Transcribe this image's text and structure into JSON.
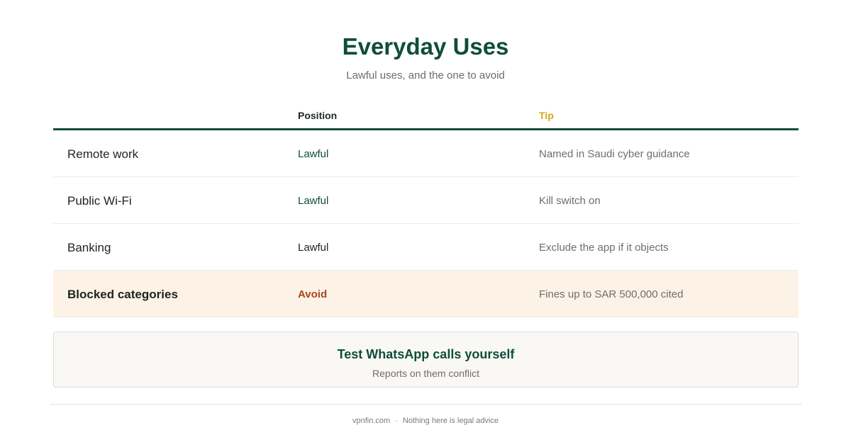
{
  "header": {
    "title": "Everyday Uses",
    "subtitle": "Lawful uses, and the one to avoid"
  },
  "table": {
    "columns": [
      "",
      "Position",
      "Tip"
    ],
    "rows": [
      {
        "name": "Remote work",
        "position": "Lawful",
        "tip": "Named in Saudi cyber guidance"
      },
      {
        "name": "Public Wi-Fi",
        "position": "Lawful",
        "tip": "Kill switch on"
      },
      {
        "name": "Banking",
        "position": "Lawful",
        "tip": "Exclude the app if it objects"
      },
      {
        "name": "Blocked categories",
        "position": "Avoid",
        "tip": "Fines up to SAR 500,000 cited"
      }
    ]
  },
  "callout": {
    "title": "Test WhatsApp calls yourself",
    "subtitle": "Reports on them conflict"
  },
  "footer": {
    "site": "vpnfin.com",
    "separator": "·",
    "note": "Nothing here is legal advice"
  },
  "colors": {
    "accent": "#0f4d3b",
    "tip_header": "#d9a21b",
    "avoid": "#a8451e",
    "highlight_row": "#fdf2e6"
  }
}
